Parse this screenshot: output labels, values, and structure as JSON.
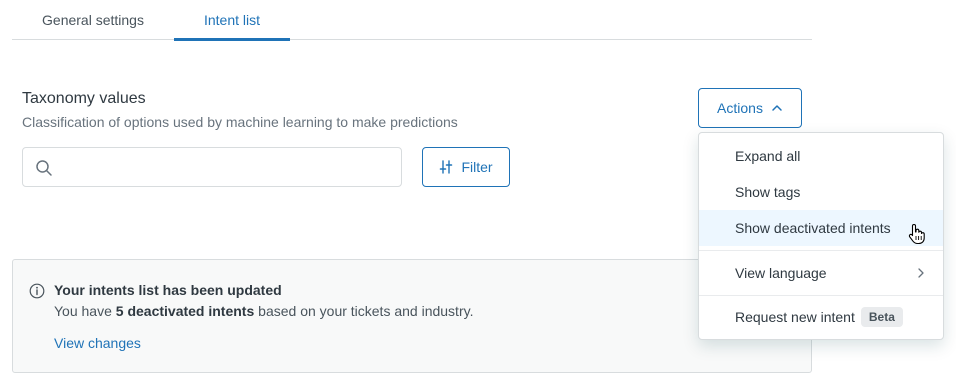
{
  "tabs": [
    {
      "label": "General settings",
      "active": false
    },
    {
      "label": "Intent list",
      "active": true
    }
  ],
  "section": {
    "title": "Taxonomy values",
    "subtitle": "Classification of options used by machine learning to make predictions"
  },
  "search": {
    "placeholder": "",
    "value": ""
  },
  "filter": {
    "label": "Filter"
  },
  "actions": {
    "label": "Actions",
    "expanded": true
  },
  "menu": {
    "items": [
      {
        "label": "Expand all"
      },
      {
        "label": "Show tags"
      },
      {
        "label": "Show deactivated intents",
        "highlighted": true
      },
      {
        "label": "View language",
        "submenu": true
      },
      {
        "label": "Request new intent",
        "badge": "Beta"
      }
    ]
  },
  "notice": {
    "title": "Your intents list has been updated",
    "body_prefix": "You have ",
    "body_bold": "5 deactivated intents",
    "body_suffix": " based on your tickets and industry.",
    "link": "View changes"
  },
  "colors": {
    "accent": "#1f73b7",
    "text": "#2f3941",
    "muted": "#68737d",
    "border": "#d8dcde",
    "highlight": "#edf7ff"
  }
}
